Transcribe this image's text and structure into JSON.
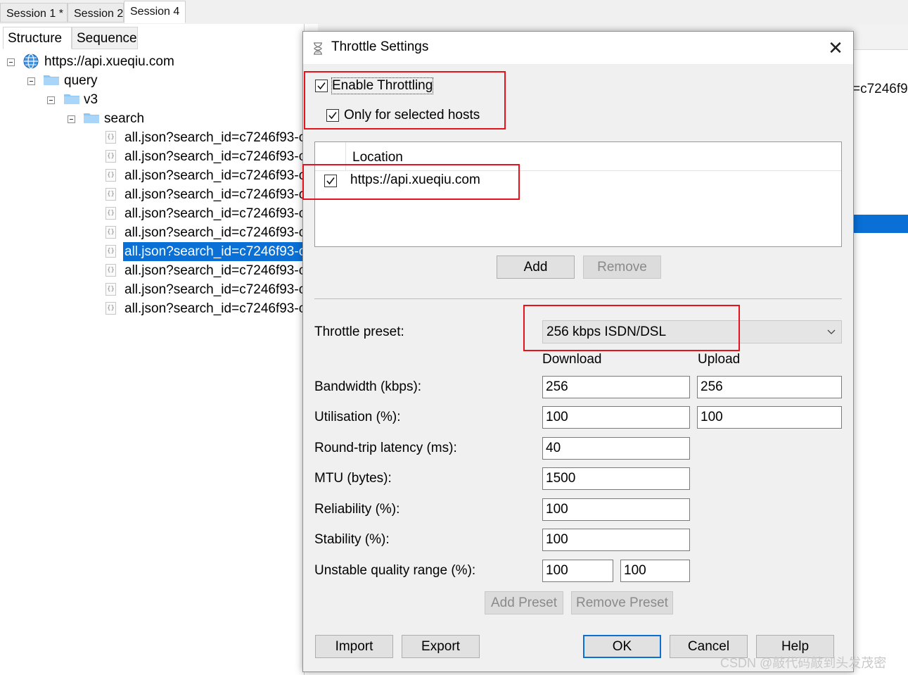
{
  "session_tabs": [
    {
      "label": "Session 1 *"
    },
    {
      "label": "Session 2"
    },
    {
      "label": "Session 4"
    }
  ],
  "view_tabs": [
    {
      "label": "Structure"
    },
    {
      "label": "Sequence"
    }
  ],
  "tree": {
    "host": "https://api.xueqiu.com",
    "folders": [
      "query",
      "v3",
      "search"
    ],
    "items": [
      "all.json?search_id=c7246f93-c",
      "all.json?search_id=c7246f93-c",
      "all.json?search_id=c7246f93-c",
      "all.json?search_id=c7246f93-c",
      "all.json?search_id=c7246f93-c",
      "all.json?search_id=c7246f93-c",
      "all.json?search_id=c7246f93-c",
      "all.json?search_id=c7246f93-c",
      "all.json?search_id=c7246f93-c",
      "all.json?search_id=c7246f93-c"
    ],
    "selected_index": 6
  },
  "right_pane": {
    "snippet": "=c7246f9"
  },
  "dialog": {
    "title": "Throttle Settings",
    "close_symbol": "✕",
    "enable_throttling": {
      "label": "Enable Throttling",
      "checked": true
    },
    "only_selected_hosts": {
      "label": "Only for selected hosts",
      "checked": true
    },
    "locations": {
      "header": "Location",
      "rows": [
        {
          "host": "https://api.xueqiu.com",
          "checked": true
        }
      ]
    },
    "add_label": "Add",
    "remove_label": "Remove",
    "preset_label": "Throttle preset:",
    "preset_value": "256 kbps ISDN/DSL",
    "col_download": "Download",
    "col_upload": "Upload",
    "fields": {
      "bandwidth": {
        "label": "Bandwidth (kbps):",
        "download": "256",
        "upload": "256"
      },
      "utilisation": {
        "label": "Utilisation (%):",
        "download": "100",
        "upload": "100"
      },
      "latency": {
        "label": "Round-trip latency (ms):",
        "value": "40"
      },
      "mtu": {
        "label": "MTU (bytes):",
        "value": "1500"
      },
      "reliability": {
        "label": "Reliability (%):",
        "value": "100"
      },
      "stability": {
        "label": "Stability (%):",
        "value": "100"
      },
      "unstable": {
        "label": "Unstable quality range (%):",
        "low": "100",
        "high": "100"
      }
    },
    "add_preset_label": "Add Preset",
    "remove_preset_label": "Remove Preset",
    "buttons": {
      "import": "Import",
      "export": "Export",
      "ok": "OK",
      "cancel": "Cancel",
      "help": "Help"
    }
  },
  "watermark": "CSDN @敲代码敲到头发茂密",
  "colors": {
    "selection": "#0a70d6",
    "annotation": "#e8131a"
  }
}
